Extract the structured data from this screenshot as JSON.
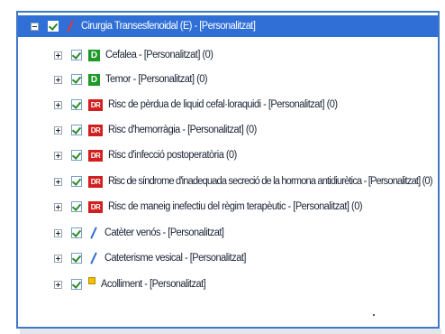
{
  "tree": {
    "root": {
      "label": "Cirurgia Transesfenoidal (E) - [Personalitzat]"
    },
    "items": [
      {
        "icon": "D",
        "icon_name": "diagnosis-d-icon",
        "label": "Cefalea - [Personalitzat] (0)"
      },
      {
        "icon": "D",
        "icon_name": "diagnosis-d-icon",
        "label": "Temor - [Personalitzat] (0)"
      },
      {
        "icon": "DR",
        "icon_name": "risk-dr-icon",
        "label": "Risc de pèrdua de liquid cefal·loraquidi - [Personalitzat] (0)"
      },
      {
        "icon": "DR",
        "icon_name": "risk-dr-icon",
        "label": "Risc d'hemorràgia - [Personalitzat] (0)"
      },
      {
        "icon": "DR",
        "icon_name": "risk-dr-icon",
        "label": "Risc d'infecció postoperatòria (0)"
      },
      {
        "icon": "DR",
        "icon_name": "risk-dr-icon",
        "label": "Risc de síndrome d'inadequada secreció de la hormona antidiurètica - [Personalitzat] (0)"
      },
      {
        "icon": "DR",
        "icon_name": "risk-dr-icon",
        "label": "Risc de maneig inefectiu del règim terapèutic - [Personalitzat] (0)"
      },
      {
        "icon": "pencil",
        "icon_name": "pencil-icon",
        "label": "Catèter venós - [Personalitzat]"
      },
      {
        "icon": "pencil",
        "icon_name": "pencil-icon",
        "label": "Cateterisme vesical - [Personalitzat]"
      },
      {
        "icon": "note",
        "icon_name": "note-icon",
        "label": "Acolliment - [Personalitzat]"
      }
    ]
  },
  "colors": {
    "selection": "#2f6fd6",
    "diagnosis": "#1f9a2a",
    "risk": "#d11f1f",
    "border": "#3f78c4"
  }
}
